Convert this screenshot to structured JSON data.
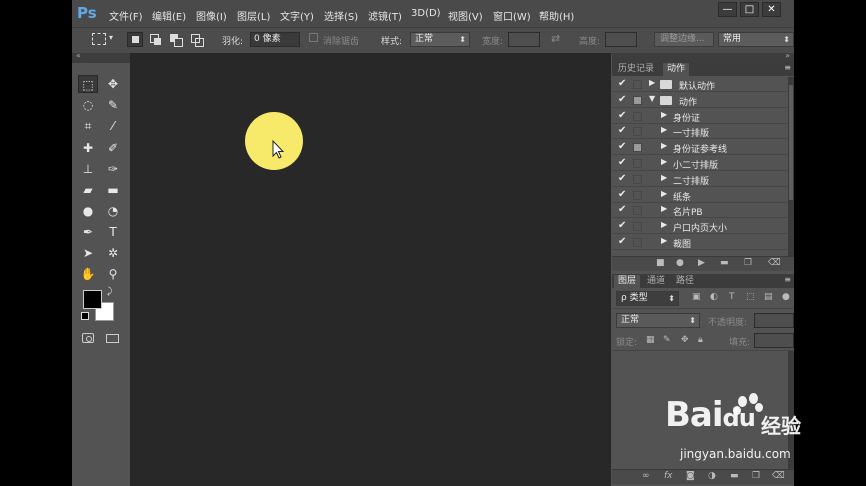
{
  "app": {
    "logo": "Ps"
  },
  "menubar": {
    "items": [
      "文件(F)",
      "编辑(E)",
      "图像(I)",
      "图层(L)",
      "文字(Y)",
      "选择(S)",
      "滤镜(T)",
      "3D(D)",
      "视图(V)",
      "窗口(W)",
      "帮助(H)"
    ],
    "window_buttons": [
      "—",
      "□",
      "✕"
    ]
  },
  "options": {
    "feather_label": "羽化:",
    "feather_value": "0 像素",
    "antialias_label": "消除锯齿",
    "style_label": "样式:",
    "style_value": "正常",
    "width_label": "宽度:",
    "height_label": "高度:",
    "refine_edge": "调整边缘...",
    "workspace": "常用"
  },
  "toolbox": {
    "tools": [
      {
        "name": "rect-marquee-tool",
        "glyph": "⬚"
      },
      {
        "name": "move-tool",
        "glyph": "✥"
      },
      {
        "name": "lasso-tool",
        "glyph": "◌"
      },
      {
        "name": "quick-select-tool",
        "glyph": "✎"
      },
      {
        "name": "crop-tool",
        "glyph": "⌗"
      },
      {
        "name": "eyedropper-tool",
        "glyph": "⁄"
      },
      {
        "name": "healing-brush-tool",
        "glyph": "✚"
      },
      {
        "name": "brush-tool",
        "glyph": "✐"
      },
      {
        "name": "stamp-tool",
        "glyph": "⊥"
      },
      {
        "name": "history-brush-tool",
        "glyph": "✑"
      },
      {
        "name": "eraser-tool",
        "glyph": "▰"
      },
      {
        "name": "gradient-tool",
        "glyph": "▬"
      },
      {
        "name": "blur-tool",
        "glyph": "●"
      },
      {
        "name": "dodge-tool",
        "glyph": "◔"
      },
      {
        "name": "pen-tool",
        "glyph": "✒"
      },
      {
        "name": "type-tool",
        "glyph": "T"
      },
      {
        "name": "path-select-tool",
        "glyph": "➤"
      },
      {
        "name": "shape-tool",
        "glyph": "✲"
      },
      {
        "name": "hand-tool",
        "glyph": "✋"
      },
      {
        "name": "zoom-tool",
        "glyph": "⚲"
      }
    ],
    "foreground_color": "#000000",
    "background_color": "#ffffff"
  },
  "actions_panel": {
    "tabs": [
      "历史记录",
      "动作"
    ],
    "active_tab": "动作",
    "rows": [
      {
        "label": "默认动作",
        "level": 0,
        "folder": true,
        "expanded": false
      },
      {
        "label": "动作",
        "level": 0,
        "folder": true,
        "expanded": true
      },
      {
        "label": "身份证",
        "level": 1
      },
      {
        "label": "一寸排版",
        "level": 1
      },
      {
        "label": "身份证参考线",
        "level": 1
      },
      {
        "label": "小二寸排版",
        "level": 1
      },
      {
        "label": "二寸排版",
        "level": 1
      },
      {
        "label": "纸条",
        "level": 1
      },
      {
        "label": "名片PB",
        "level": 1
      },
      {
        "label": "户口内页大小",
        "level": 1
      },
      {
        "label": "裁图",
        "level": 1
      }
    ]
  },
  "layers_panel": {
    "tabs": [
      "图层",
      "通道",
      "路径"
    ],
    "active_tab": "图层",
    "filter": "ρ 类型",
    "blend_mode": "正常",
    "opacity_label": "不透明度:",
    "lock_label": "锁定:",
    "fill_label": "填充:"
  },
  "watermark": {
    "brand": "Bai",
    "brand2": "du",
    "suffix": "经验",
    "url": "jingyan.baidu.com"
  },
  "colors": {
    "accent_logo": "#5ea9e6",
    "canvas": "#282828",
    "cursor_highlight": "#f7e96a"
  }
}
